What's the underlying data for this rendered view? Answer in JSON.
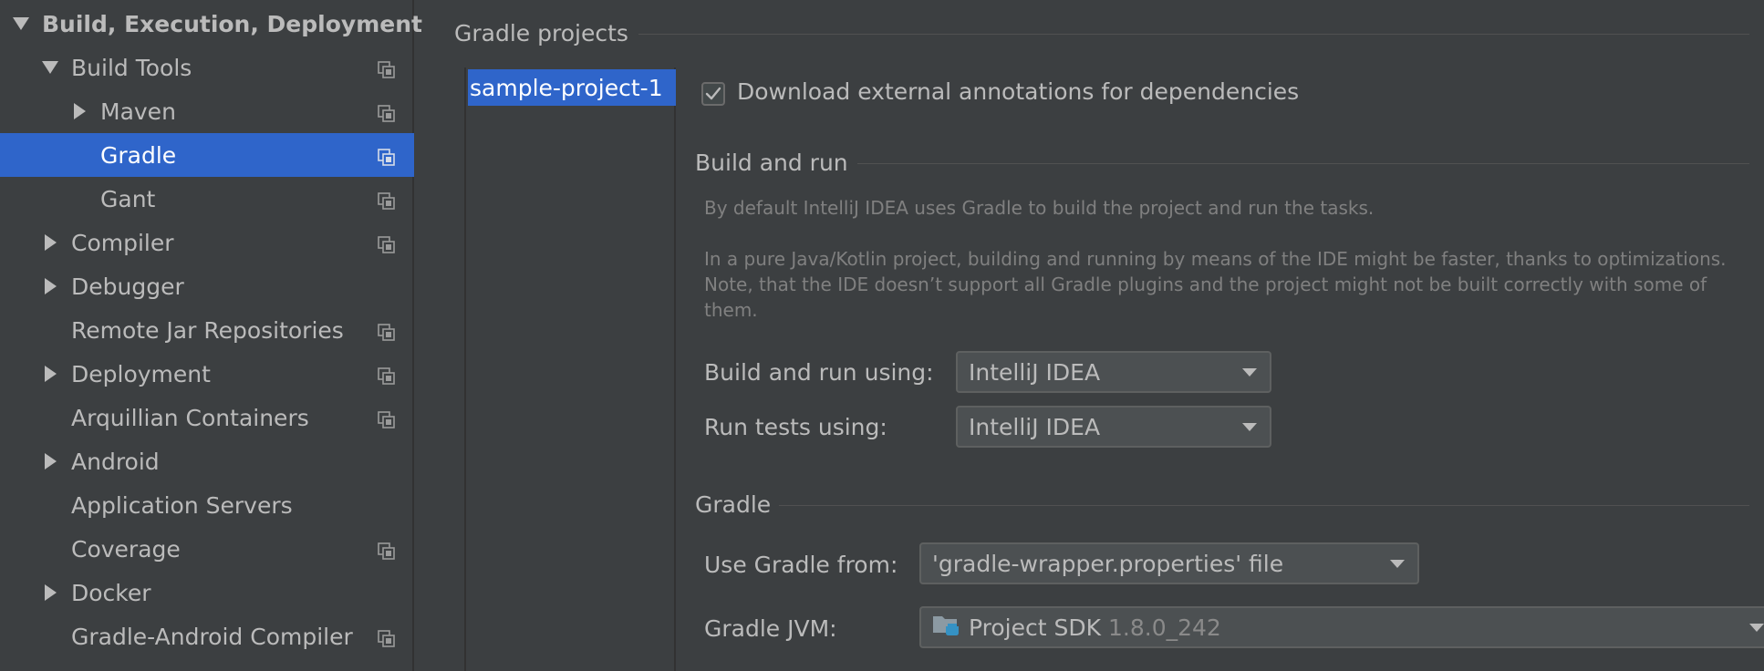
{
  "sidebar": {
    "items": [
      {
        "label": "Build, Execution, Deployment",
        "arrow": "expanded",
        "copy": false,
        "selected": false,
        "bold": true
      },
      {
        "label": "Build Tools",
        "arrow": "expanded",
        "copy": true,
        "selected": false,
        "bold": false
      },
      {
        "label": "Maven",
        "arrow": "collapsed",
        "copy": true,
        "selected": false,
        "bold": false
      },
      {
        "label": "Gradle",
        "arrow": "none",
        "copy": true,
        "selected": true,
        "bold": false
      },
      {
        "label": "Gant",
        "arrow": "none",
        "copy": true,
        "selected": false,
        "bold": false
      },
      {
        "label": "Compiler",
        "arrow": "collapsed",
        "copy": true,
        "selected": false,
        "bold": false
      },
      {
        "label": "Debugger",
        "arrow": "collapsed",
        "copy": false,
        "selected": false,
        "bold": false
      },
      {
        "label": "Remote Jar Repositories",
        "arrow": "none",
        "copy": true,
        "selected": false,
        "bold": false
      },
      {
        "label": "Deployment",
        "arrow": "collapsed",
        "copy": true,
        "selected": false,
        "bold": false
      },
      {
        "label": "Arquillian Containers",
        "arrow": "none",
        "copy": true,
        "selected": false,
        "bold": false
      },
      {
        "label": "Android",
        "arrow": "collapsed",
        "copy": false,
        "selected": false,
        "bold": false
      },
      {
        "label": "Application Servers",
        "arrow": "none",
        "copy": false,
        "selected": false,
        "bold": false
      },
      {
        "label": "Coverage",
        "arrow": "none",
        "copy": true,
        "selected": false,
        "bold": false
      },
      {
        "label": "Docker",
        "arrow": "collapsed",
        "copy": false,
        "selected": false,
        "bold": false
      },
      {
        "label": "Gradle-Android Compiler",
        "arrow": "none",
        "copy": true,
        "selected": false,
        "bold": false
      }
    ]
  },
  "main": {
    "gradle_projects_title": "Gradle projects",
    "project_name": "sample-project-1",
    "download_annotations": {
      "label": "Download external annotations for dependencies",
      "checked": true
    },
    "build_and_run": {
      "title": "Build and run",
      "desc_line1": "By default IntelliJ IDEA uses Gradle to build the project and run the tasks.",
      "desc_line2": "In a pure Java/Kotlin project, building and running by means of the IDE might be faster, thanks to optimizations.",
      "desc_line3": "Note, that the IDE doesn’t support all Gradle plugins and the project might not be built correctly with some of",
      "desc_line4": "them.",
      "build_run_label": "Build and run using:",
      "build_run_value": "IntelliJ IDEA",
      "run_tests_label": "Run tests using:",
      "run_tests_value": "IntelliJ IDEA"
    },
    "gradle": {
      "title": "Gradle",
      "use_gradle_label": "Use Gradle from:",
      "use_gradle_value": "'gradle-wrapper.properties' file",
      "jvm_label": "Gradle JVM:",
      "jvm_value": "Project SDK",
      "jvm_version": "1.8.0_242"
    }
  },
  "colors": {
    "background": "#3c3f41",
    "selection": "#2f65ca",
    "text": "#bbbbbb",
    "muted_text": "#808080"
  }
}
